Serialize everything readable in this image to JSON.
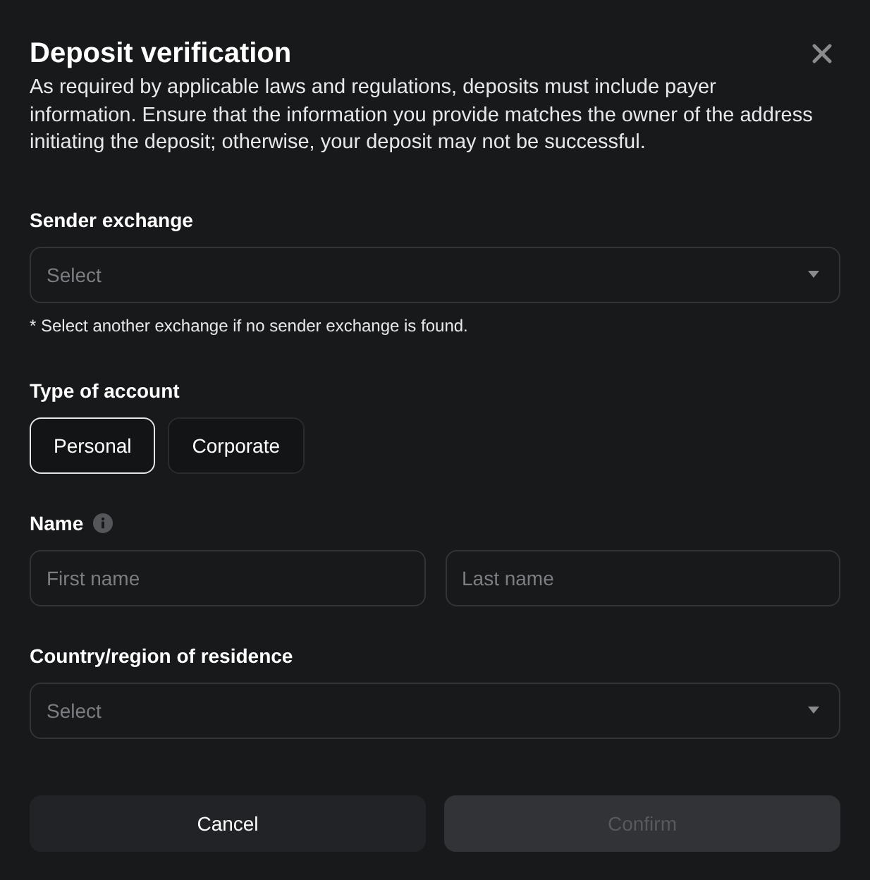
{
  "dialog": {
    "title": "Deposit verification",
    "description": "As required by applicable laws and regulations, deposits must include payer information. Ensure that the information you provide matches the owner of the address initiating the deposit; otherwise, your deposit may not be successful."
  },
  "sender_exchange": {
    "label": "Sender exchange",
    "placeholder": "Select",
    "note": "* Select another exchange if no sender exchange is found."
  },
  "account_type": {
    "label": "Type of account",
    "options": [
      {
        "label": "Personal",
        "selected": true
      },
      {
        "label": "Corporate",
        "selected": false
      }
    ]
  },
  "name": {
    "label": "Name",
    "first_name": {
      "placeholder": "First name"
    },
    "last_name": {
      "placeholder": "Last name"
    }
  },
  "country": {
    "label": "Country/region of residence",
    "placeholder": "Select"
  },
  "buttons": [
    {
      "label": "Cancel",
      "disabled": false
    },
    {
      "label": "Confirm",
      "disabled": true
    }
  ]
}
